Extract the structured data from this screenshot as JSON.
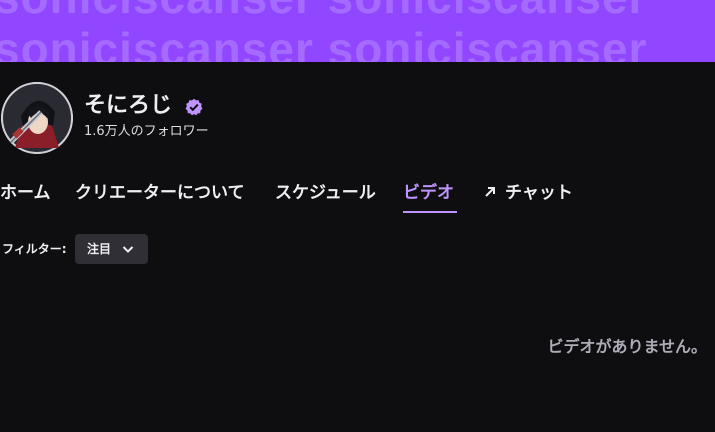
{
  "banner": {
    "watermark_line1": "soniciscanser soniciscanser",
    "watermark_line2": "soniciscanser soniciscanser"
  },
  "channel": {
    "name": "そにろじ",
    "followers": "1.6万人のフォロワー",
    "verified_icon": "verified-badge-icon"
  },
  "tabs": [
    {
      "label": "ホーム"
    },
    {
      "label": "クリエーターについて"
    },
    {
      "label": "スケジュール"
    },
    {
      "label": "ビデオ",
      "active": true
    },
    {
      "label": "チャット",
      "icon": "external-arrow-icon"
    }
  ],
  "filter": {
    "label": "フィルター:",
    "selected": "注目"
  },
  "empty_message": "ビデオがありません。",
  "colors": {
    "accent": "#9147ff",
    "accent_text": "#bf94ff",
    "background": "#0e0e10",
    "muted": "#adadb8"
  }
}
